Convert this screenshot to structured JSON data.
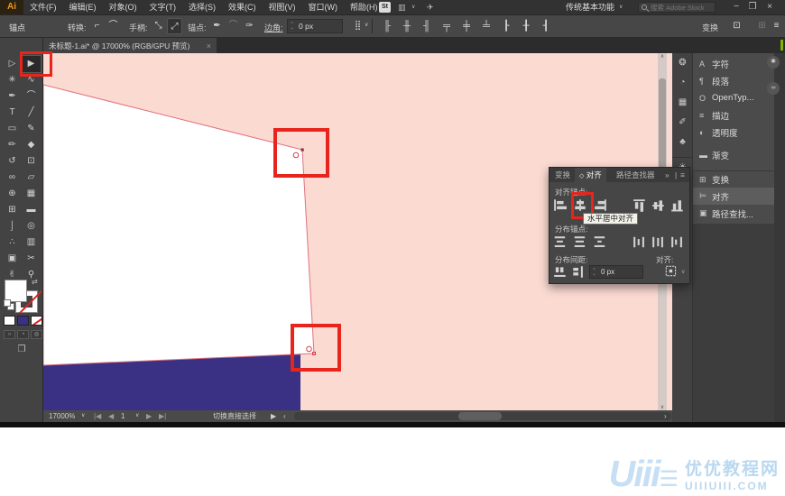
{
  "menubar": {
    "logo": "Ai",
    "items": [
      {
        "label": "文件(F)"
      },
      {
        "label": "编辑(E)"
      },
      {
        "label": "对象(O)"
      },
      {
        "label": "文字(T)"
      },
      {
        "label": "选择(S)"
      },
      {
        "label": "效果(C)"
      },
      {
        "label": "视图(V)"
      },
      {
        "label": "窗口(W)"
      },
      {
        "label": "帮助(H)"
      }
    ],
    "bridge_glyph": "▦",
    "stock_label": "St",
    "arrange_glyph": "▥",
    "share_glyph": "✈",
    "workspace_label": "传统基本功能",
    "search_placeholder": "搜索 Adobe Stock",
    "minimize": "−",
    "restore": "❐",
    "close": "×",
    "chevron": "∨"
  },
  "controlbar": {
    "context_label": "锚点",
    "convert_label": "转换:",
    "convert_icons": [
      {
        "name": "convert-to-corner-icon",
        "glyph": "⌐"
      },
      {
        "name": "convert-to-smooth-icon",
        "glyph": "⌒"
      }
    ],
    "handles_label": "手柄:",
    "handle_icons": [
      {
        "name": "show-handles-icon",
        "glyph": "⤡"
      },
      {
        "name": "hide-handles-icon",
        "glyph": "⤢",
        "selected": true
      }
    ],
    "anchors_label": "锚点:",
    "anchor_icons": [
      {
        "name": "connect-anchors-icon",
        "glyph": "✒"
      },
      {
        "name": "cut-path-icon",
        "glyph": "⌒",
        "disabled": true
      },
      {
        "name": "remove-anchor-icon",
        "glyph": "✑"
      }
    ],
    "corner_label": "边角:",
    "corner_value": "0 px",
    "similar_glyph": "⣿",
    "align_icons": [
      {
        "name": "align-left-icon",
        "glyph": "╟"
      },
      {
        "name": "align-h-center-icon",
        "glyph": "╫"
      },
      {
        "name": "align-right-icon",
        "glyph": "╢"
      },
      {
        "name": "align-top-icon",
        "glyph": "╤"
      },
      {
        "name": "align-v-center-icon",
        "glyph": "╪"
      },
      {
        "name": "align-bottom-icon",
        "glyph": "╧"
      },
      {
        "name": "distribute-left-icon",
        "glyph": "┠"
      },
      {
        "name": "distribute-center-icon",
        "glyph": "╂"
      },
      {
        "name": "distribute-right-icon",
        "glyph": "┨"
      }
    ],
    "transform_label": "变换",
    "isolate_glyph": "⊡",
    "dim_glyph": "⊞",
    "menu_glyph": "≡",
    "chevron": "∨"
  },
  "tab": {
    "title": "未标题-1.ai* @ 17000% (RGB/GPU 预览)",
    "close": "×"
  },
  "toolbar": {
    "tools": [
      {
        "name": "selection-tool",
        "glyph": "▷"
      },
      {
        "name": "direct-selection-tool",
        "glyph": "▶",
        "selected": true
      },
      {
        "name": "magic-wand-tool",
        "glyph": "✳"
      },
      {
        "name": "lasso-tool",
        "glyph": "∿"
      },
      {
        "name": "pen-tool",
        "glyph": "✒"
      },
      {
        "name": "curvature-tool",
        "glyph": "⌒"
      },
      {
        "name": "type-tool",
        "glyph": "T"
      },
      {
        "name": "line-segment-tool",
        "glyph": "╱"
      },
      {
        "name": "rectangle-tool",
        "glyph": "▭"
      },
      {
        "name": "paintbrush-tool",
        "glyph": "✎"
      },
      {
        "name": "shaper-tool",
        "glyph": "✏"
      },
      {
        "name": "eraser-tool",
        "glyph": "◆"
      },
      {
        "name": "rotate-tool",
        "glyph": "↺"
      },
      {
        "name": "scale-tool",
        "glyph": "⊡"
      },
      {
        "name": "width-tool",
        "glyph": "∞"
      },
      {
        "name": "free-transform-tool",
        "glyph": "▱"
      },
      {
        "name": "shape-builder-tool",
        "glyph": "⊕"
      },
      {
        "name": "perspective-grid-tool",
        "glyph": "▦"
      },
      {
        "name": "mesh-tool",
        "glyph": "⊞"
      },
      {
        "name": "gradient-tool",
        "glyph": "▬"
      },
      {
        "name": "eyedropper-tool",
        "glyph": "⌡"
      },
      {
        "name": "blend-tool",
        "glyph": "◎"
      },
      {
        "name": "symbol-sprayer-tool",
        "glyph": "∴"
      },
      {
        "name": "graph-tool",
        "glyph": "▥"
      },
      {
        "name": "artboard-tool",
        "glyph": "▣"
      },
      {
        "name": "slice-tool",
        "glyph": "✂"
      },
      {
        "name": "hand-tool",
        "glyph": "✌"
      },
      {
        "name": "zoom-tool",
        "glyph": "⚲"
      }
    ],
    "swap_glyph": "⇄",
    "screen_mode_glyph": "❐"
  },
  "canvas": {
    "colors": {
      "background": "#fbdad2",
      "shape_white": "#ffffff",
      "shape_blue": "#3a3184",
      "selection_stroke": "#e0737f",
      "anchor_red": "#d7404f",
      "anchor_dark": "#8a2f3d"
    }
  },
  "align_panel": {
    "tabs": [
      {
        "label": "变换"
      },
      {
        "label": "对齐",
        "active": true
      },
      {
        "label": "路径查找器"
      }
    ],
    "dirty_glyph": "◇",
    "collapse_glyph": "»",
    "menu_glyph": "≡",
    "align_label": "对齐锚点:",
    "distribute_label": "分布锚点:",
    "spacing_label": "分布间距:",
    "spacing_value": "0 px",
    "align_to_label": "对齐:",
    "tooltip": "水平居中对齐"
  },
  "flyout": {
    "items": [
      {
        "glyph": "A",
        "label": "字符"
      },
      {
        "glyph": "¶",
        "label": "段落"
      },
      {
        "glyph": "O",
        "label": "OpenTyp..."
      },
      {
        "glyph": "≡",
        "label": "描边"
      },
      {
        "glyph": "◐",
        "label": "透明度"
      },
      {
        "glyph": "▬",
        "label": "渐变"
      },
      {
        "glyph": "⊞",
        "label": "变换"
      },
      {
        "glyph": "⊨",
        "label": "对齐",
        "selected": true
      },
      {
        "glyph": "▣",
        "label": "路径查找..."
      }
    ]
  },
  "dock": {
    "icons": [
      {
        "name": "color-panel-icon",
        "glyph": "❂"
      },
      {
        "name": "color-guide-panel-icon",
        "glyph": "◔"
      },
      {
        "name": "swatches-panel-icon",
        "glyph": "▦"
      },
      {
        "name": "brushes-panel-icon",
        "glyph": "✐"
      },
      {
        "name": "symbols-panel-icon",
        "glyph": "♣"
      },
      {
        "name": "appearance-panel-icon",
        "glyph": "☀"
      }
    ],
    "sync_glyph": "✱",
    "cc_glyph": "∞"
  },
  "statusbar": {
    "zoom": "17000%",
    "artboard": "1",
    "status": "切换直接选择",
    "nav_first": "|◀",
    "nav_prev": "◀",
    "nav_next": "▶",
    "nav_last": "▶|",
    "marker": "▶",
    "left_arrow": "‹",
    "right_arrow": "›",
    "chevron": "∨"
  },
  "watermark": {
    "logo": "Uiii",
    "logo_bars": "☰",
    "brand": "优优教程网",
    "site": "UIIIUIII.COM"
  }
}
